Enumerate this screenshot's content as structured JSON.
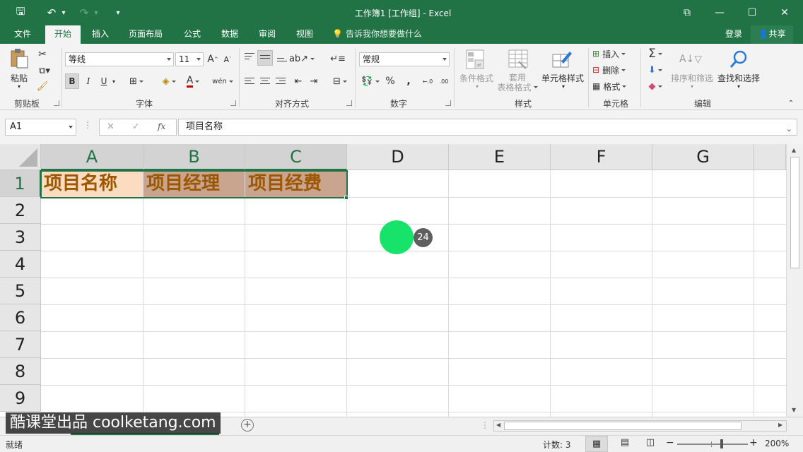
{
  "window": {
    "title": "工作簿1 [工作组] - Excel",
    "qa_save": "🖫",
    "qa_undo": "↶",
    "qa_redo": "↷",
    "qa_more": "⌄",
    "btn_ribbon_opts": "⧉",
    "btn_min": "—",
    "btn_max": "☐",
    "btn_close": "✕"
  },
  "tabs": [
    "文件",
    "开始",
    "插入",
    "页面布局",
    "公式",
    "数据",
    "审阅",
    "视图"
  ],
  "active_tab": "开始",
  "tell_me": "告诉我你想要做什么",
  "login": "登录",
  "share": "共享",
  "ribbon": {
    "clipboard": {
      "paste": "粘贴",
      "label": "剪贴板"
    },
    "font": {
      "name": "等线",
      "size": "11",
      "grow": "A",
      "shrink": "A",
      "bold": "B",
      "italic": "I",
      "underline": "U",
      "wen": "wén",
      "label": "字体"
    },
    "align": {
      "label": "对齐方式"
    },
    "number": {
      "format": "常规",
      "percent": "%",
      "comma": ",",
      "inc": ".00",
      "label": "数字"
    },
    "styles": {
      "conditional": "条件格式",
      "table_line1": "套用",
      "table_line2": "表格格式",
      "cell_styles": "单元格样式",
      "label": "样式"
    },
    "cells": {
      "insert": "插入",
      "delete": "删除",
      "format": "格式",
      "label": "单元格"
    },
    "editing": {
      "sigma": "Σ",
      "sort_filter": "排序和筛选",
      "find_select": "查找和选择",
      "label": "编辑"
    }
  },
  "formula_bar": {
    "name_box": "A1",
    "cancel": "✕",
    "enter": "✓",
    "fx": "fx",
    "content": "项目名称"
  },
  "sheet": {
    "columns": [
      "A",
      "B",
      "C",
      "D",
      "E",
      "F",
      "G"
    ],
    "rows": [
      "1",
      "2",
      "3",
      "4",
      "5",
      "6",
      "7",
      "8",
      "9"
    ],
    "cells": {
      "A1": "项目名称",
      "B1": "项目经理",
      "C1": "项目经费"
    },
    "colors": {
      "A1_fill": "#fcdcc0",
      "BC1_fill": "#c9a48f",
      "text": "#9c5700",
      "accent": "#217346"
    }
  },
  "marker_badge": "24",
  "watermark": "酷课堂出品 coolketang.com",
  "add_sheet": "+",
  "status": {
    "ready": "就绪",
    "count": "计数: 3",
    "zoom_minus": "−",
    "zoom_plus": "+",
    "zoom": "200%"
  }
}
